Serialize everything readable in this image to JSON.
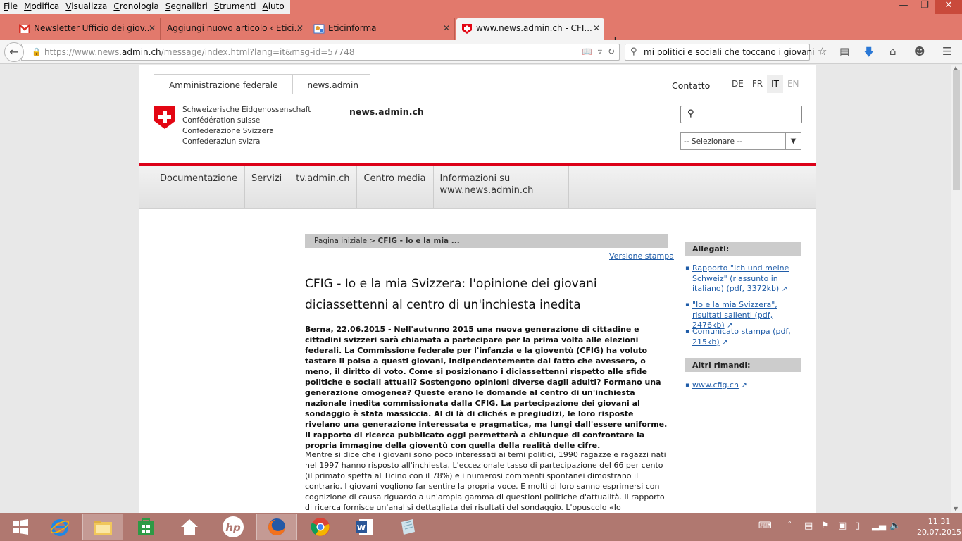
{
  "menu": [
    "File",
    "Modifica",
    "Visualizza",
    "Cronologia",
    "Segnalibri",
    "Strumenti",
    "Aiuto"
  ],
  "tabs": [
    {
      "title": "Newsletter Ufficio dei giov...",
      "icon": "gmail-icon"
    },
    {
      "title": "Aggiungi nuovo articolo ‹ Etici...",
      "icon": "wordpress-icon"
    },
    {
      "title": "Eticinforma",
      "icon": "site-icon"
    },
    {
      "title": "www.news.admin.ch - CFI...",
      "icon": "swiss-cross-icon"
    }
  ],
  "address": {
    "prefix": "https://www.news.",
    "domain": "admin.ch",
    "suffix": "/message/index.html?lang=it&msg-id=57748"
  },
  "search": {
    "value": "mi politici e sociali che toccano i giovani"
  },
  "site": {
    "breadcrumb_top": [
      "Amministrazione federale",
      "news.admin"
    ],
    "contact": "Contatto",
    "languages": [
      "DE",
      "FR",
      "IT",
      "EN"
    ],
    "confed_lines": [
      "Schweizerische Eidgenossenschaft",
      "Confédération suisse",
      "Confederazione Svizzera",
      "Confederaziun svizra"
    ],
    "site_name": "news.admin.ch",
    "select_placeholder": "-- Selezionare --",
    "nav": [
      "Documentazione",
      "Servizi",
      "tv.admin.ch",
      "Centro media",
      "Informazioni su www.news.admin.ch"
    ]
  },
  "article": {
    "crumb_home": "Pagina iniziale",
    "crumb_sep": ">",
    "crumb_current": "CFIG - Io e la mia ...",
    "print_version": "Versione stampa",
    "title": "CFIG - Io e la mia Svizzera: l'opinione dei giovani diciassettenni al centro di un'inchiesta inedita",
    "lead": "Berna, 22.06.2015 - Nell'autunno 2015 una nuova generazione di cittadine e cittadini svizzeri sarà chiamata a partecipare per la prima volta alle elezioni federali. La Commissione federale per l'infanzia e la gioventù (CFIG) ha voluto tastare il polso a questi giovani, indipendentemente dal fatto che avessero, o meno, il diritto di voto. Come si posizionano i diciassettenni rispetto alle sfide politiche e sociali attuali? Sostengono opinioni diverse dagli adulti? Formano una generazione omogenea? Queste erano le domande al centro di un'inchiesta nazionale inedita commissionata dalla CFIG. La partecipazione dei giovani al sondaggio è stata massiccia. Al di là di clichés e pregiudizi, le loro risposte rivelano una generazione interessata e pragmatica, ma lungi dall'essere uniforme. Il rapporto di ricerca pubblicato oggi permetterà a chiunque di confrontare la propria immagine della gioventù con quella della realità delle cifre.",
    "body": "Mentre si dice che i giovani sono poco interessati ai temi politici, 1990 ragazze e ragazzi nati nel 1997 hanno risposto all'inchiesta. L'eccezionale tasso di partecipazione del 66 per cento (il primato spetta al Ticino con il 78%) e i numerosi commenti spontanei dimostrano il contrario. I giovani vogliono far sentire la propria voce. E molti di loro sanno esprimersi con cognizione di causa riguardo a un'ampia gamma di questioni politiche d'attualità. Il rapporto di ricerca fornisce un'analisi dettagliata dei risultati del sondaggio. L'opuscolo «Io"
  },
  "sidebar": {
    "attachments_title": "Allegati:",
    "attachments": [
      "Rapporto \"Ich und meine Schweiz\" (riassunto in italiano) (pdf, 3372kb)",
      "\"Io e la mia Svizzera\", risultati salienti (pdf, 2476kb)",
      "Comunicato stampa (pdf, 215kb)"
    ],
    "links_title": "Altri rimandi:",
    "links": [
      "www.cfig.ch"
    ]
  },
  "taskbar": {
    "time": "11:31",
    "date": "20.07.2015"
  }
}
